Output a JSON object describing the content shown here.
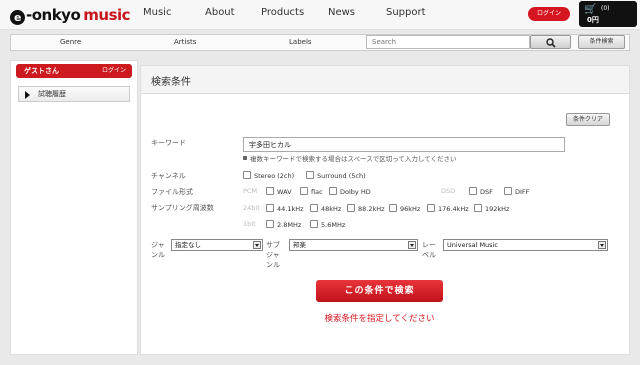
{
  "header": {
    "logo_e": "e",
    "logo_text": "-onkyo",
    "logo_music": "music",
    "nav": [
      "Music",
      "About",
      "Products",
      "News",
      "Support"
    ],
    "login_label": "ログイン",
    "cart_count": "(0)",
    "cart_price": "0円"
  },
  "subnav": {
    "categories": [
      "Genre",
      "Artists",
      "Labels"
    ],
    "search_placeholder": "Search",
    "advanced_label": "条件検索"
  },
  "sidebar": {
    "guest_name": "ゲストさん",
    "guest_login": "ログイン",
    "history_label": "試聴履歴"
  },
  "main": {
    "title": "検索条件",
    "clear_label": "条件クリア",
    "keyword_label": "キーワード",
    "keyword_value": "宇多田ヒカル",
    "keyword_note": "複数キーワードで検索する場合はスペースで区切って入力してください",
    "channel_label": "チャンネル",
    "channels": [
      "Stereo (2ch)",
      "Surround (5ch)"
    ],
    "format_label": "ファイル形式",
    "pcm_label": "PCM",
    "pcm_formats": [
      "WAV",
      "flac",
      "Dolby HD"
    ],
    "dsd_label": "DSD",
    "dsd_formats": [
      "DSF",
      "DIFF"
    ],
    "sampling_label": "サンプリング周波数",
    "bit24_label": "24bit",
    "bit24_rates": [
      "44.1kHz",
      "48kHz",
      "88.2kHz",
      "96kHz",
      "176.4kHz",
      "192kHz"
    ],
    "bit1_label": "1bit",
    "bit1_rates": [
      "2.8MHz",
      "5.6MHz"
    ],
    "genre_label": "ジャンル",
    "genre_value": "指定なし",
    "subgenre_label": "サブジャンル",
    "subgenre_value": "邦楽",
    "label_label": "レーベル",
    "label_value": "Universal Music",
    "search_button": "この条件で検索",
    "warning": "検索条件を指定してください"
  }
}
